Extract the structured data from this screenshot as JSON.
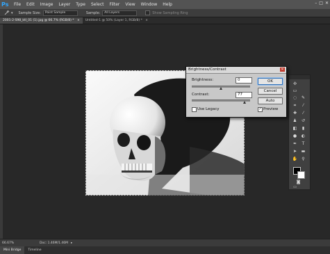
{
  "app": {
    "logo": "Ps"
  },
  "menu": [
    "File",
    "Edit",
    "Image",
    "Layer",
    "Type",
    "Select",
    "Filter",
    "View",
    "Window",
    "Help"
  ],
  "window_controls": {
    "minimize": "–",
    "maximize": "□",
    "close": "✕"
  },
  "options": {
    "sample_size_label": "Sample Size:",
    "sample_size_value": "Point Sample",
    "sample_label": "Sample:",
    "sample_value": "All Layers",
    "show_ring_label": "Show Sampling Ring"
  },
  "tabs": [
    {
      "label": "2001-2-S98_ktl_01 (1).jpg @ 66.7% (RGB/8) *"
    },
    {
      "label": "Untitled-1 @ 50% (Layer 1, RGB/8) *"
    }
  ],
  "status": {
    "zoom": "66.67%",
    "doc": "Doc: 1.46M/1.46M"
  },
  "bottom_tabs": [
    "Mini Bridge",
    "Timeline"
  ],
  "dialog": {
    "title": "Brightness/Contrast",
    "brightness_label": "Brightness:",
    "brightness_value": "0",
    "contrast_label": "Contrast:",
    "contrast_value": "77",
    "ok_label": "OK",
    "cancel_label": "Cancel",
    "auto_label": "Auto",
    "use_legacy_label": "Use Legacy",
    "use_legacy_checked": false,
    "preview_label": "Preview",
    "preview_checked": true
  },
  "colors": {
    "accent": "#31a8ff",
    "foreground": "#000000",
    "background": "#ffffff"
  }
}
